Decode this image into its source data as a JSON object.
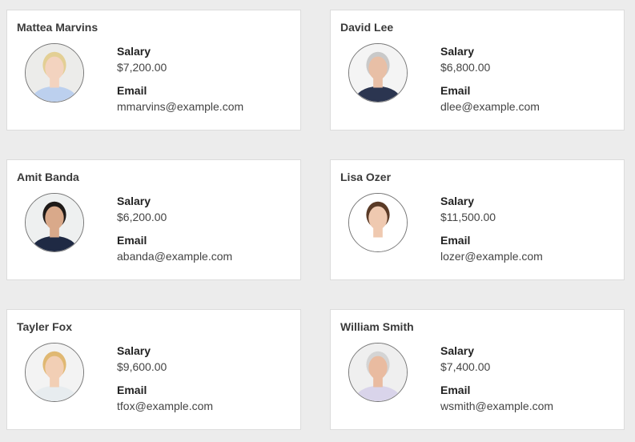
{
  "labels": {
    "salary": "Salary",
    "email": "Email"
  },
  "employees": [
    {
      "name": "Mattea Marvins",
      "salary": "$7,200.00",
      "email": "mmarvins@example.com",
      "avatar": {
        "icon": "person-photo",
        "hair": "#e3cf94",
        "skin": "#f3d3bf",
        "shirt": "#bcd0ee",
        "bg": "#ececea"
      }
    },
    {
      "name": "David Lee",
      "salary": "$6,800.00",
      "email": "dlee@example.com",
      "avatar": {
        "icon": "person-photo",
        "hair": "#c9c9c9",
        "skin": "#e8bfa6",
        "shirt": "#2b3550",
        "bg": "#f4f4f4"
      }
    },
    {
      "name": "Amit Banda",
      "salary": "$6,200.00",
      "email": "abanda@example.com",
      "avatar": {
        "icon": "person-photo",
        "hair": "#1e1a18",
        "skin": "#d9a98a",
        "shirt": "#1f2a44",
        "bg": "#eef0f0"
      }
    },
    {
      "name": "Lisa Ozer",
      "salary": "$11,500.00",
      "email": "lozer@example.com",
      "avatar": {
        "icon": "person-photo",
        "hair": "#5a3a26",
        "skin": "#efc9b0",
        "shirt": "#ffffff",
        "bg": "#ffffff"
      }
    },
    {
      "name": "Tayler Fox",
      "salary": "$9,600.00",
      "email": "tfox@example.com",
      "avatar": {
        "icon": "person-photo",
        "hair": "#e0b872",
        "skin": "#f2cfb5",
        "shirt": "#e7ecef",
        "bg": "#f3f3f3"
      }
    },
    {
      "name": "William Smith",
      "salary": "$7,400.00",
      "email": "wsmith@example.com",
      "avatar": {
        "icon": "person-photo",
        "hair": "#d4d4d4",
        "skin": "#e9bba0",
        "shirt": "#d9d4ea",
        "bg": "#efefef"
      }
    }
  ]
}
